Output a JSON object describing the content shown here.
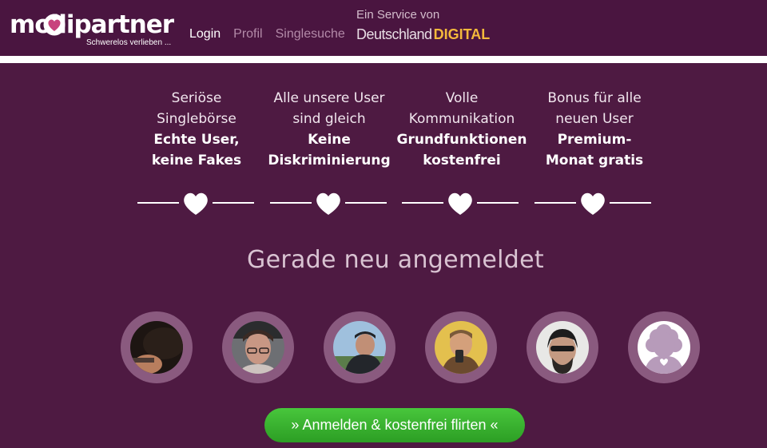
{
  "header": {
    "logo_text": "mollipartner",
    "logo_tagline": "Schwerelos verlieben ...",
    "nav": {
      "login": "Login",
      "profil": "Profil",
      "singlesuche": "Singlesuche"
    },
    "service_label": "Ein Service von",
    "service_brand_a": "Deutschland",
    "service_brand_b": "DIGITAL"
  },
  "features": [
    {
      "line1": "Seriöse",
      "line2": "Singlebörse",
      "bold1": "Echte User,",
      "bold2": "keine Fakes"
    },
    {
      "line1": "Alle unsere User",
      "line2": "sind gleich",
      "bold1": "Keine",
      "bold2": "Diskriminierung"
    },
    {
      "line1": "Volle",
      "line2": "Kommunikation",
      "bold1": "Grundfunktionen",
      "bold2": "kostenfrei"
    },
    {
      "line1": "Bonus für alle",
      "line2": "neuen User",
      "bold1": "Premium-",
      "bold2": "Monat gratis"
    }
  ],
  "section_title": "Gerade neu angemeldet",
  "cta_label": "» Anmelden & kostenfrei flirten «",
  "colors": {
    "background": "#4e1a42",
    "header": "#4a1540",
    "accent_gold": "#f4b93b",
    "cta_green": "#3db832",
    "avatar_ring": "#8a5a7f"
  }
}
